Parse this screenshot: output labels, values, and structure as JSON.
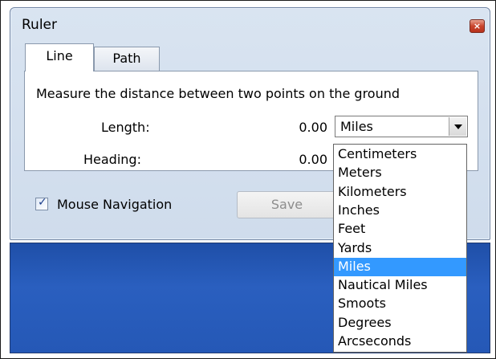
{
  "window": {
    "title": "Ruler",
    "close_glyph": "×"
  },
  "tabs": [
    {
      "label": "Line"
    },
    {
      "label": "Path"
    }
  ],
  "line_panel": {
    "description": "Measure the distance between two points on the ground",
    "length_label": "Length:",
    "length_value": "0.00",
    "heading_label": "Heading:",
    "heading_value": "0.00",
    "unit_selected": "Miles"
  },
  "footer": {
    "mouse_navigation_label": "Mouse Navigation",
    "mouse_navigation_checked": true,
    "save_label": "Save"
  },
  "unit_options": [
    "Centimeters",
    "Meters",
    "Kilometers",
    "Inches",
    "Feet",
    "Yards",
    "Miles",
    "Nautical Miles",
    "Smoots",
    "Degrees",
    "Arcseconds"
  ],
  "selected_option": "Miles",
  "colors": {
    "selection": "#3399ff",
    "desktop": "#2558b6",
    "window_chrome": "#d4e0ef"
  }
}
